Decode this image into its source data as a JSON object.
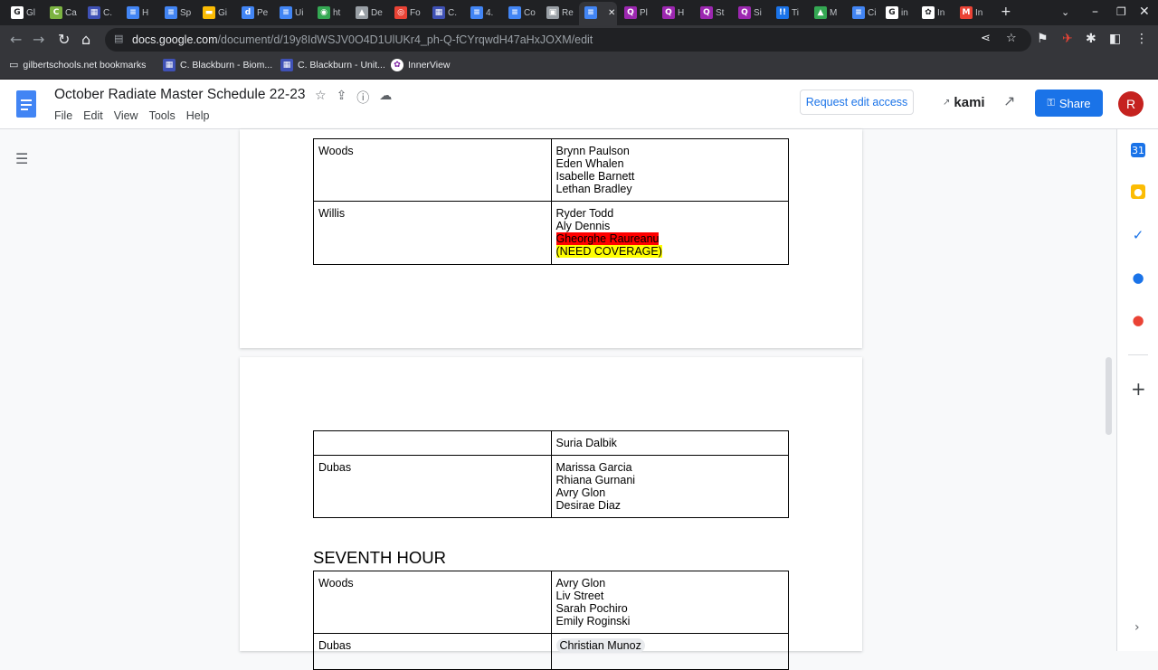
{
  "browser": {
    "tabs": [
      {
        "label": "Gl",
        "icon": "G",
        "color": "#ffffff"
      },
      {
        "label": "Ca",
        "icon": "C",
        "color": "#7cb342"
      },
      {
        "label": "C.",
        "icon": "▦",
        "color": "#3f51b5"
      },
      {
        "label": "H",
        "icon": "≡",
        "color": "#4285f4"
      },
      {
        "label": "Sp",
        "icon": "≡",
        "color": "#4285f4"
      },
      {
        "label": "Gi",
        "icon": "▬",
        "color": "#fbbc04"
      },
      {
        "label": "Pe",
        "icon": "d",
        "color": "#4285f4"
      },
      {
        "label": "Ui",
        "icon": "≡",
        "color": "#4285f4"
      },
      {
        "label": "ht",
        "icon": "◉",
        "color": "#34a853"
      },
      {
        "label": "De",
        "icon": "▲",
        "color": "#9aa0a6"
      },
      {
        "label": "Fo",
        "icon": "◎",
        "color": "#ea4335"
      },
      {
        "label": "C.",
        "icon": "▦",
        "color": "#3f51b5"
      },
      {
        "label": "4.",
        "icon": "≡",
        "color": "#4285f4"
      },
      {
        "label": "Co",
        "icon": "≡",
        "color": "#4285f4"
      },
      {
        "label": "Re",
        "icon": "▣",
        "color": "#9aa0a6"
      },
      {
        "label": "",
        "icon": "≡",
        "color": "#4285f4"
      },
      {
        "label": "Pl",
        "icon": "Q",
        "color": "#9c27b0"
      },
      {
        "label": "H",
        "icon": "Q",
        "color": "#9c27b0"
      },
      {
        "label": "St",
        "icon": "Q",
        "color": "#9c27b0"
      },
      {
        "label": "Si",
        "icon": "Q",
        "color": "#9c27b0"
      },
      {
        "label": "Ti",
        "icon": "!!",
        "color": "#1a73e8"
      },
      {
        "label": "M",
        "icon": "▲",
        "color": "#34a853"
      },
      {
        "label": "Ci",
        "icon": "≡",
        "color": "#4285f4"
      },
      {
        "label": "in",
        "icon": "G",
        "color": "#ffffff"
      },
      {
        "label": "In",
        "icon": "✿",
        "color": "#ffffff"
      },
      {
        "label": "In",
        "icon": "M",
        "color": "#ea4335"
      }
    ],
    "url_host": "docs.google.com",
    "url_path": "/document/d/19y8IdWSJV0O4D1UlUKr4_ph-Q-fCYrqwdH47aHxJOXM/edit",
    "bookmarks": [
      {
        "label": "gilbertschools.net bookmarks"
      },
      {
        "label": "C. Blackburn - Biom..."
      },
      {
        "label": "C. Blackburn - Unit..."
      },
      {
        "label": "InnerView"
      }
    ]
  },
  "docs": {
    "title": "October Radiate Master Schedule 22-23",
    "menu": [
      "File",
      "Edit",
      "View",
      "Tools",
      "Help"
    ],
    "request_edit": "Request edit access",
    "kami": "kami",
    "share": "Share",
    "avatar_letter": "R"
  },
  "page1": {
    "rows": [
      {
        "teacher": "Woods",
        "students": [
          "Brynn Paulson",
          "Eden Whalen",
          "Isabelle Barnett",
          "Lethan Bradley"
        ]
      },
      {
        "teacher": "Willis",
        "students": [
          "Ryder Todd",
          "Aly Dennis"
        ],
        "flagged": "Gheorghe Raureanu",
        "note": "(NEED COVERAGE)"
      }
    ]
  },
  "page2": {
    "rows_top": [
      {
        "teacher": "",
        "students": [
          "Suria Dalbik"
        ]
      },
      {
        "teacher": "Dubas",
        "students": [
          "Marissa Garcia",
          "Rhiana Gurnani",
          "Avry Glon",
          "Desirae Diaz"
        ]
      }
    ],
    "heading": "SEVENTH HOUR",
    "rows_bottom": [
      {
        "teacher": "Woods",
        "students": [
          "Avry Glon",
          "Liv Street",
          "Sarah Pochiro",
          "Emily Roginski"
        ]
      },
      {
        "teacher": "Dubas",
        "chip": "Christian Munoz"
      }
    ]
  }
}
